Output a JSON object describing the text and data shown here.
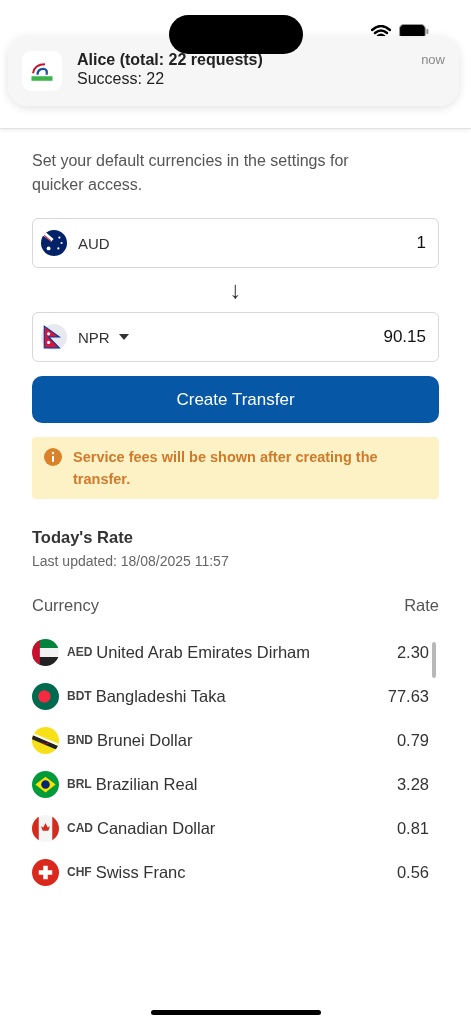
{
  "notification": {
    "title": "Alice (total: 22 requests)",
    "body": "Success: 22",
    "time": "now"
  },
  "intro": "Set your default currencies in the settings for quicker access.",
  "converter": {
    "from": {
      "kind": "australia",
      "currency": "AUD",
      "amount": "1"
    },
    "arrow": "↓",
    "to": {
      "kind": "nepal",
      "currency": "NPR",
      "amount": "90.15",
      "dropdown": true
    }
  },
  "create_button": "Create Transfer",
  "notice": "Service fees will be shown after creating the transfer.",
  "rates": {
    "title": "Today's Rate",
    "updated": "Last updated: 18/08/2025 11:57",
    "columns": [
      "Currency",
      "Rate"
    ],
    "rows": [
      {
        "kind": "uae",
        "code": "AED",
        "name": "United Arab Emirates Dirham",
        "rate": "2.30"
      },
      {
        "kind": "bangladesh",
        "code": "BDT",
        "name": "Bangladeshi Taka",
        "rate": "77.63"
      },
      {
        "kind": "brunei",
        "code": "BND",
        "name": "Brunei Dollar",
        "rate": "0.79"
      },
      {
        "kind": "brazil",
        "code": "BRL",
        "name": "Brazilian Real",
        "rate": "3.28"
      },
      {
        "kind": "canada",
        "code": "CAD",
        "name": "Canadian Dollar",
        "rate": "0.81"
      },
      {
        "kind": "swiss",
        "code": "CHF",
        "name": "Swiss Franc",
        "rate": "0.56"
      }
    ]
  }
}
